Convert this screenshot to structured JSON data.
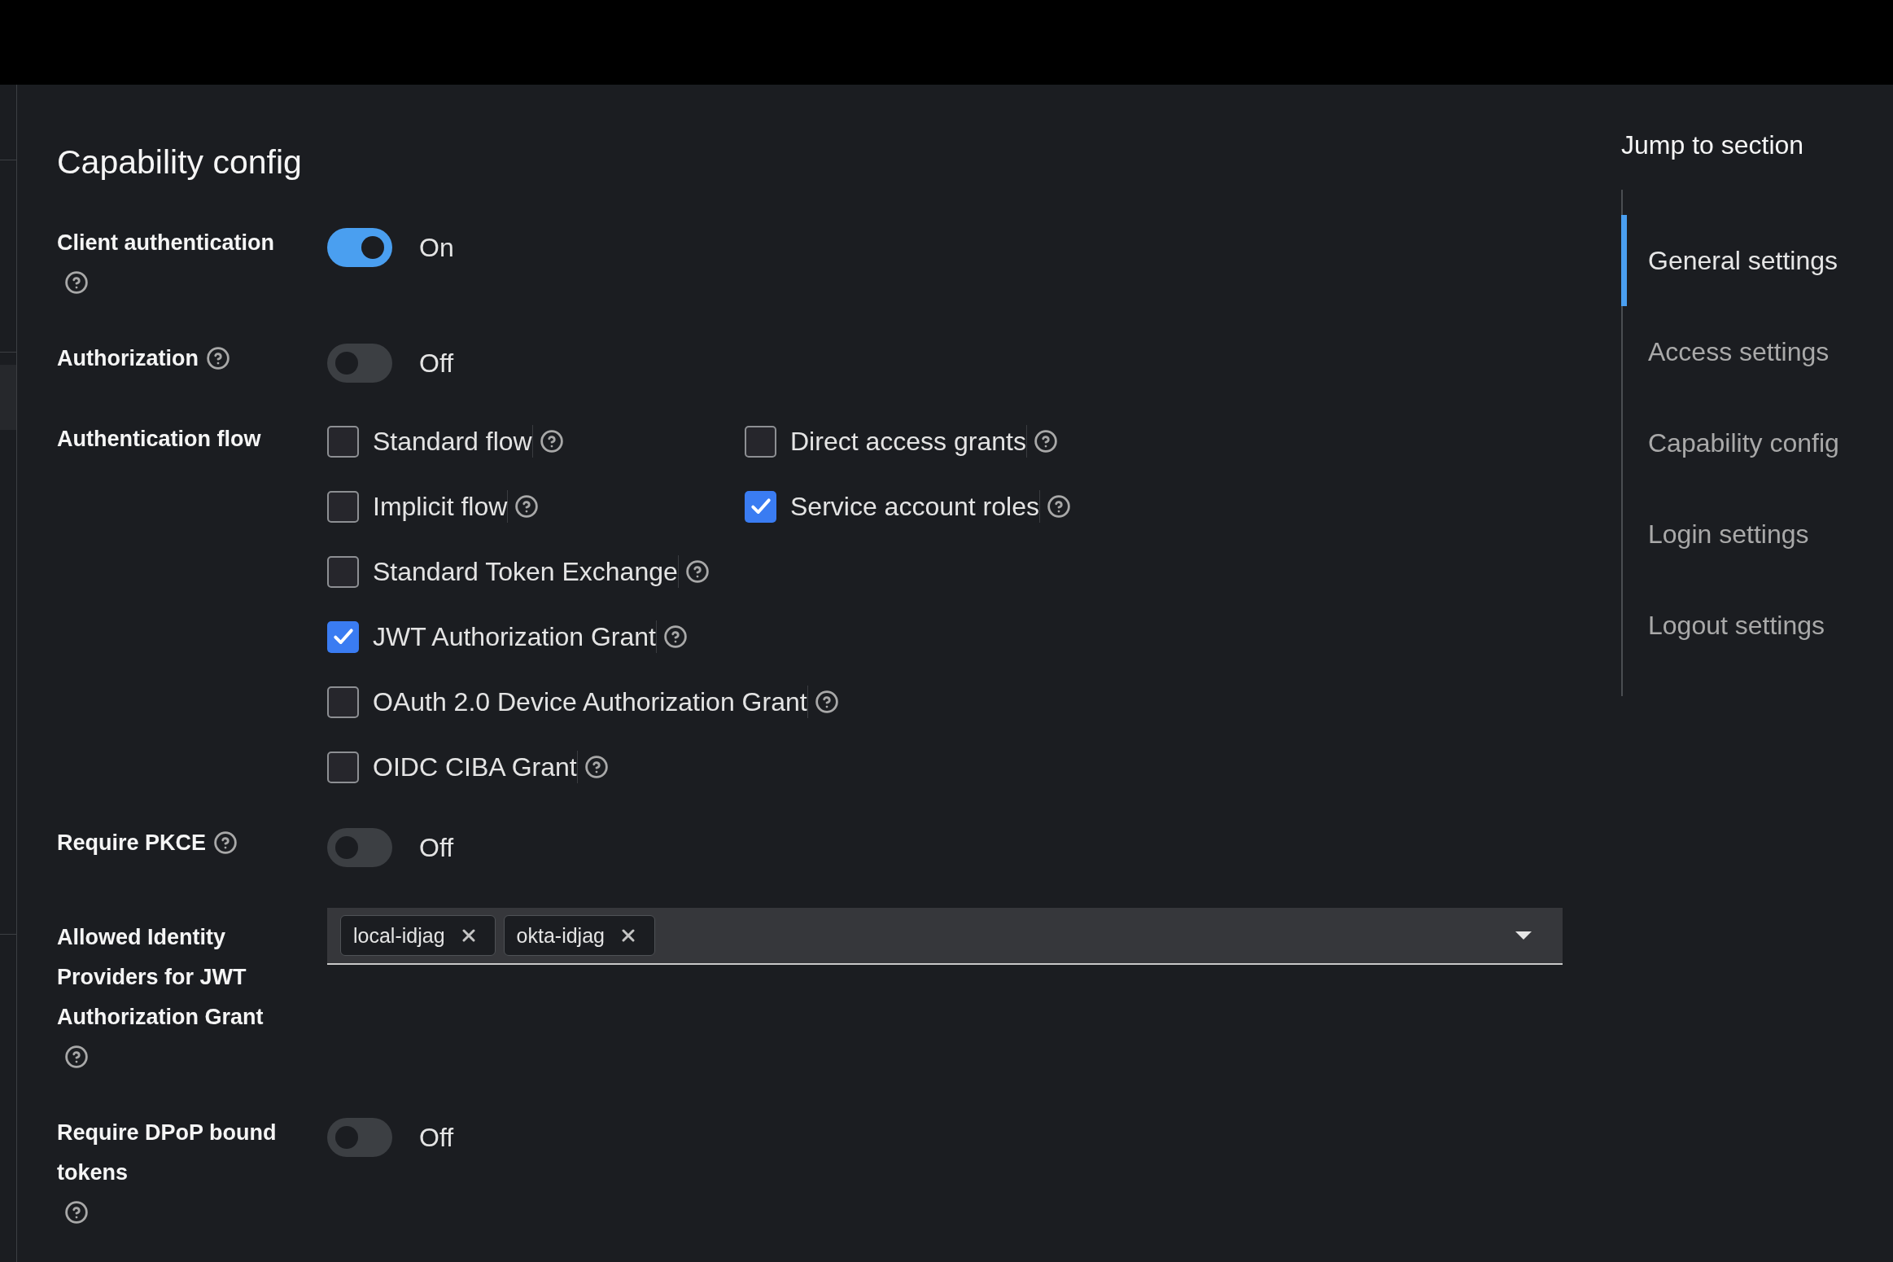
{
  "section_title": "Capability config",
  "fields": [
    {
      "kind": "toggle",
      "label": "Client authentication",
      "help": true,
      "on": true,
      "state_label": "On"
    },
    {
      "kind": "toggle",
      "label": "Authorization",
      "help": true,
      "on": false,
      "state_label": "Off"
    },
    {
      "kind": "checkboxes",
      "label": "Authentication flow",
      "help": false,
      "rows": [
        {
          "options": [
            {
              "label": "Standard flow",
              "checked": false
            },
            {
              "label": "Direct access grants",
              "checked": false
            }
          ]
        },
        {
          "options": [
            {
              "label": "Implicit flow",
              "checked": false
            },
            {
              "label": "Service account roles",
              "checked": true
            }
          ]
        },
        {
          "options": [
            {
              "label": "Standard Token Exchange",
              "checked": false
            }
          ]
        },
        {
          "options": [
            {
              "label": "JWT Authorization Grant",
              "checked": true
            }
          ]
        },
        {
          "options": [
            {
              "label": "OAuth 2.0 Device Authorization Grant",
              "checked": false
            }
          ]
        },
        {
          "options": [
            {
              "label": "OIDC CIBA Grant",
              "checked": false
            }
          ]
        }
      ]
    },
    {
      "kind": "toggle",
      "label": "Require PKCE",
      "help": true,
      "on": false,
      "state_label": "Off"
    },
    {
      "kind": "multiselect",
      "label": "Allowed Identity Providers for JWT Authorization Grant",
      "help": true,
      "chips": [
        {
          "label": "local-idjag"
        },
        {
          "label": "okta-idjag"
        }
      ]
    },
    {
      "kind": "toggle",
      "label": "Require DPoP bound tokens",
      "help": true,
      "on": false,
      "state_label": "Off"
    }
  ],
  "jump_nav": {
    "title": "Jump to section",
    "items": [
      {
        "label": "General settings",
        "selected": true
      },
      {
        "label": "Access settings",
        "selected": false
      },
      {
        "label": "Capability config",
        "selected": false
      },
      {
        "label": "Login settings",
        "selected": false
      },
      {
        "label": "Logout settings",
        "selected": false
      }
    ]
  }
}
